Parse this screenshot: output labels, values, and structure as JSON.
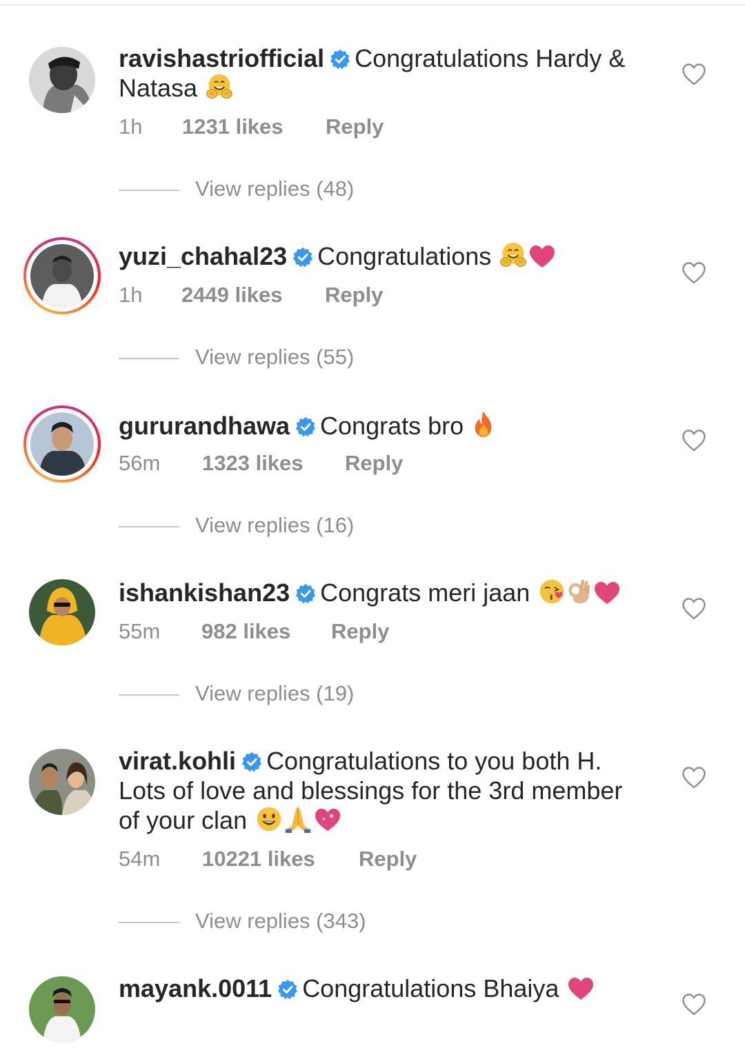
{
  "comments": [
    {
      "username": "ravishastriofficial",
      "verified": true,
      "text_line1": "Congratulations Hardy &",
      "text_line2": "Natasa",
      "emojis": [
        "hugging-face"
      ],
      "time": "1h",
      "likes": "1231 likes",
      "reply_label": "Reply",
      "view_replies": "View replies (48)",
      "story_ring": false
    },
    {
      "username": "yuzi_chahal23",
      "verified": true,
      "text_line1": "Congratulations",
      "emojis": [
        "hugging-face",
        "pink-heart"
      ],
      "time": "1h",
      "likes": "2449 likes",
      "reply_label": "Reply",
      "view_replies": "View replies (55)",
      "story_ring": true
    },
    {
      "username": "gururandhawa",
      "verified": true,
      "text_line1": "Congrats bro",
      "emojis": [
        "fire"
      ],
      "time": "56m",
      "likes": "1323 likes",
      "reply_label": "Reply",
      "view_replies": "View replies (16)",
      "story_ring": true
    },
    {
      "username": "ishankishan23",
      "verified": true,
      "text_line1": "Congrats meri jaan",
      "emojis": [
        "kissing-face",
        "ok-hand",
        "pink-heart"
      ],
      "time": "55m",
      "likes": "982 likes",
      "reply_label": "Reply",
      "view_replies": "View replies (19)",
      "story_ring": false
    },
    {
      "username": "virat.kohli",
      "verified": true,
      "text_line1": "Congratulations to you both H.",
      "text_line2": "Lots of love and blessings for the 3rd member",
      "text_line3": "of your clan",
      "emojis": [
        "smiling-face",
        "folded-hands",
        "sparkling-heart"
      ],
      "time": "54m",
      "likes": "10221 likes",
      "reply_label": "Reply",
      "view_replies": "View replies (343)",
      "story_ring": false
    },
    {
      "username": "mayank.0011",
      "verified": true,
      "text_line1": "Congratulations Bhaiya",
      "emojis": [
        "pink-heart"
      ],
      "story_ring": false
    }
  ],
  "colors": {
    "text": "#262626",
    "meta": "#8e8e8e",
    "verified_blue": "#3897f0",
    "heart_pink": "#e0457b",
    "divider": "#c7c7c7"
  },
  "icons": {
    "verified": "verified-badge-icon",
    "like": "heart-outline-icon"
  }
}
